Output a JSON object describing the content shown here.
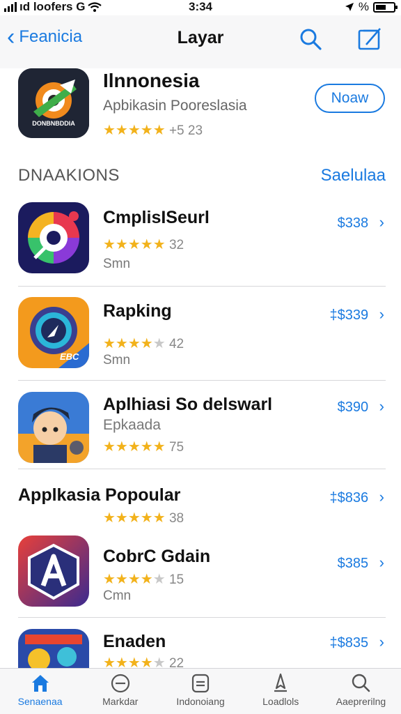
{
  "status_bar": {
    "carrier": "ıd loofers G",
    "time": "3:34",
    "right_text": "%"
  },
  "nav": {
    "back_label": "Feanicia",
    "title": "Layar",
    "search_icon": "search-icon",
    "edit_icon": "compose-icon"
  },
  "featured": {
    "name": "Ilnnonesia",
    "subtitle": "Apbikasin Pooreslasia",
    "stars": "★★★★★",
    "rating_count": "+5 23",
    "icon_caption": "DONBNBDDIA",
    "action_label": "Noaw"
  },
  "section": {
    "title": "DNAAKIONS",
    "link": "Saelulaa"
  },
  "apps": [
    {
      "name": "CmplisISeurl",
      "stars_on": "★★★★★",
      "stars_off": "",
      "rating": "32",
      "subtitle": "Smn",
      "price": "$338",
      "chevron": "›"
    },
    {
      "name": "Rapking",
      "stars_on": "★★★★",
      "stars_off": "★",
      "rating": "42",
      "subtitle": "Smn",
      "price": "‡$339",
      "chevron": "›"
    },
    {
      "name": "Aplhiasi So delswarl",
      "stars_on": "★★★★★",
      "stars_off": "",
      "rating": "75",
      "subtitle": "Epkaada",
      "price": "$390",
      "chevron": "›"
    },
    {
      "name": "Applkasia Popoular",
      "stars_on": "★★★★★",
      "stars_off": "",
      "rating": "38",
      "subtitle": "",
      "price": "‡$836",
      "chevron": "›"
    },
    {
      "name": "CobrC Gdain",
      "stars_on": "★★★★",
      "stars_off": "★",
      "rating": "15",
      "subtitle": "Cmn",
      "price": "$385",
      "chevron": "›"
    },
    {
      "name": "Enaden",
      "stars_on": "★★★★",
      "stars_off": "★",
      "rating": "22",
      "subtitle": "",
      "price": "‡$835",
      "chevron": "›"
    }
  ],
  "tabs": [
    {
      "label": "Senaenaa",
      "icon": "home-icon"
    },
    {
      "label": "Markdar",
      "icon": "circle-tab-icon"
    },
    {
      "label": "Indonoiang",
      "icon": "list-tab-icon"
    },
    {
      "label": "Loadlols",
      "icon": "rocket-icon"
    },
    {
      "label": "Aaeprerilng",
      "icon": "search-icon"
    }
  ],
  "colors": {
    "accent": "#1a7ae0",
    "star": "#f2b21b",
    "nav_bg": "#f7f7f8"
  }
}
